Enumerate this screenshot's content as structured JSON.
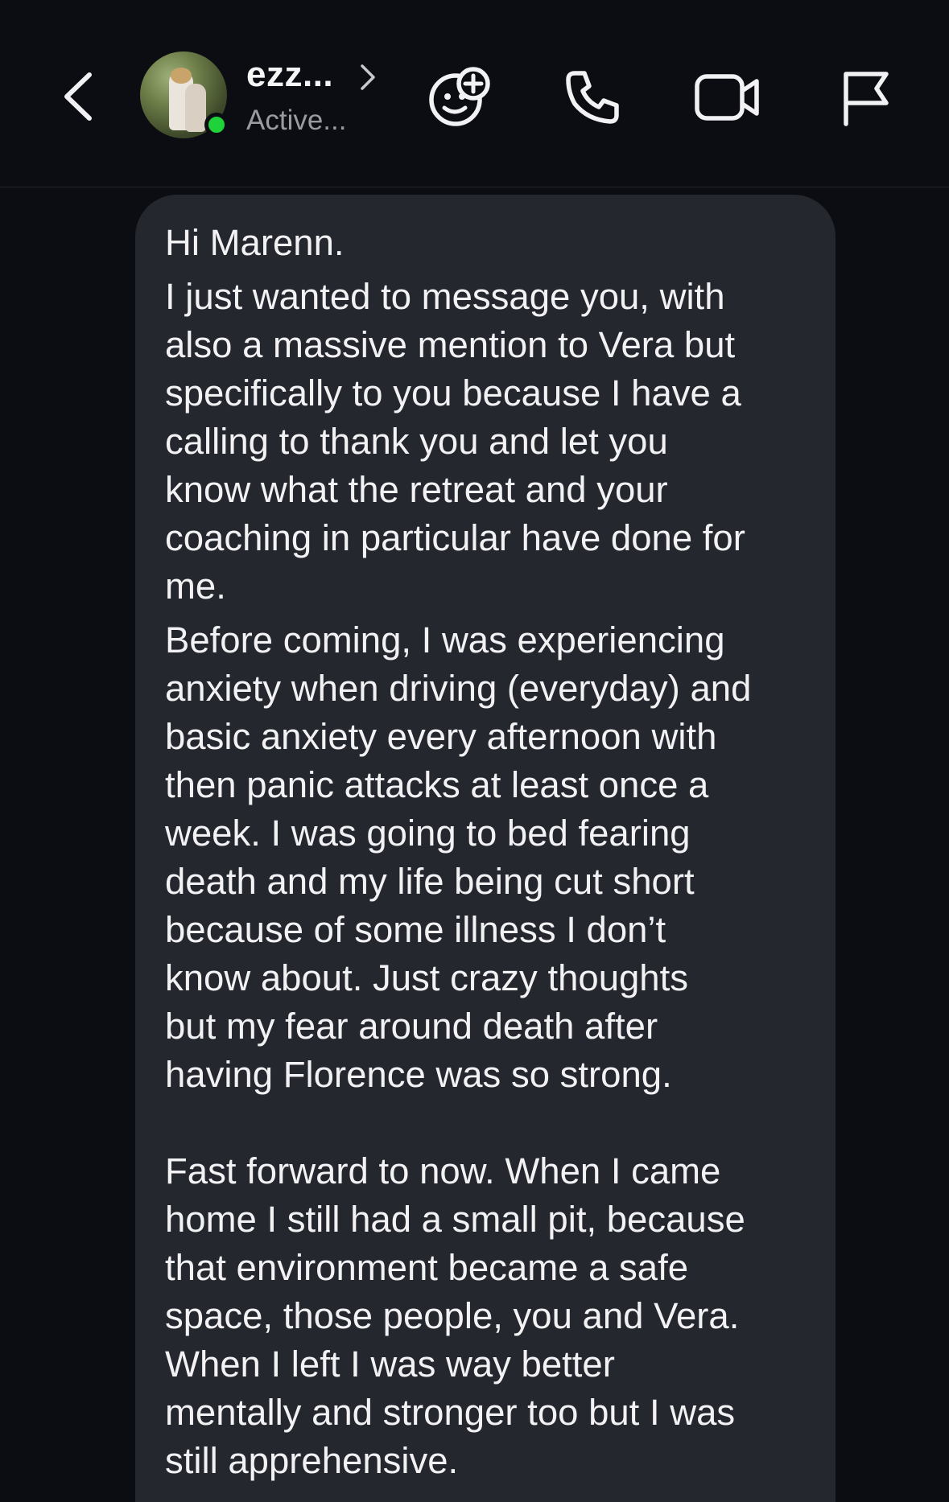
{
  "header": {
    "contact_name": "ezz...",
    "contact_status": "Active...",
    "online": true,
    "icons": {
      "back": "chevron-left-icon",
      "name_chevron": "chevron-right-icon",
      "effects": "smiley-plus-icon",
      "call": "phone-icon",
      "video": "video-camera-icon",
      "report": "flag-icon"
    }
  },
  "message": {
    "paragraphs": [
      "Hi Marenn.",
      "I just wanted to message you, with\nalso a massive mention to Vera but\nspecifically to you because I have a\ncalling to thank you and let you\nknow what the retreat and your\ncoaching in particular have done for\nme.",
      "Before coming, I was experiencing\nanxiety when driving (everyday) and\nbasic anxiety every afternoon with\nthen panic attacks at least once a\nweek. I was going to bed fearing\ndeath and my life being cut short\nbecause of some illness I don’t\nknow about. Just crazy thoughts\nbut my fear around death after\nhaving Florence was so strong.",
      "Fast forward to now. When I came\nhome I still had a small pit, because\nthat environment became a safe\nspace, those people, you and Vera.\nWhen I left I was way better\nmentally and stronger too but I was\nstill apprehensive."
    ]
  },
  "colors": {
    "background": "#0b0d12",
    "bubble": "#25272e",
    "text": "#f2f2f4",
    "secondary_text": "#9a9ba1",
    "online": "#1fd23a"
  }
}
